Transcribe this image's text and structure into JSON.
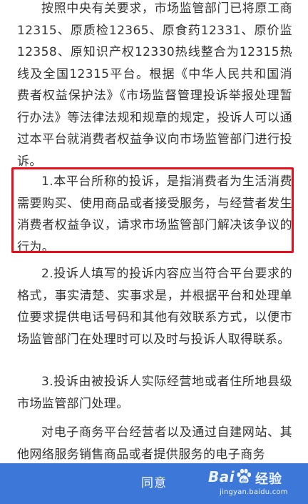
{
  "notice": {
    "paragraphs": [
      "按照中央有关要求，市场监管部门已将原工商12315、原质检12365、原食药12331、原价监12358、原知识产权12330热线整合为12315热线及全国12315平台。根据《中华人民共和国消费者权益保护法》《市场监督管理投诉举报处理暂行办法》等法律法规和规章的规定，投诉人可以通过本平台就消费者权益争议向市场监管部门进行投诉。",
      "1.本平台所称的投诉，是指消费者为生活消费需要购买、使用商品或者接受服务，与经营者发生消费者权益争议，请求市场监管部门解决该争议的行为。",
      "2.投诉人填写的投诉内容应当符合平台要求的格式，事实清楚、实事求是，并根据平台和处理单位要求提供电话号码和其他有效联系方式，以便市场监管部门在处理时可以及时与投诉人取得联系。",
      "3.投诉由被投诉人实际经营地或者住所地县级市场监管部门处理。",
      "对电子商务平台经营者以及通过自建网站、其他网络服务销售商品或者提供服务的电子商务"
    ]
  },
  "footer": {
    "agree_label": "同意"
  },
  "watermark": {
    "brand_left": "Bai",
    "brand_right": "经验",
    "url": "jingyan.baidu.com"
  },
  "colors": {
    "highlight_border": "#e60f1b",
    "agree_bar": "#3d78d8",
    "text": "#333333"
  },
  "icons": {
    "watermark_logo": "baidu-paw-icon"
  }
}
